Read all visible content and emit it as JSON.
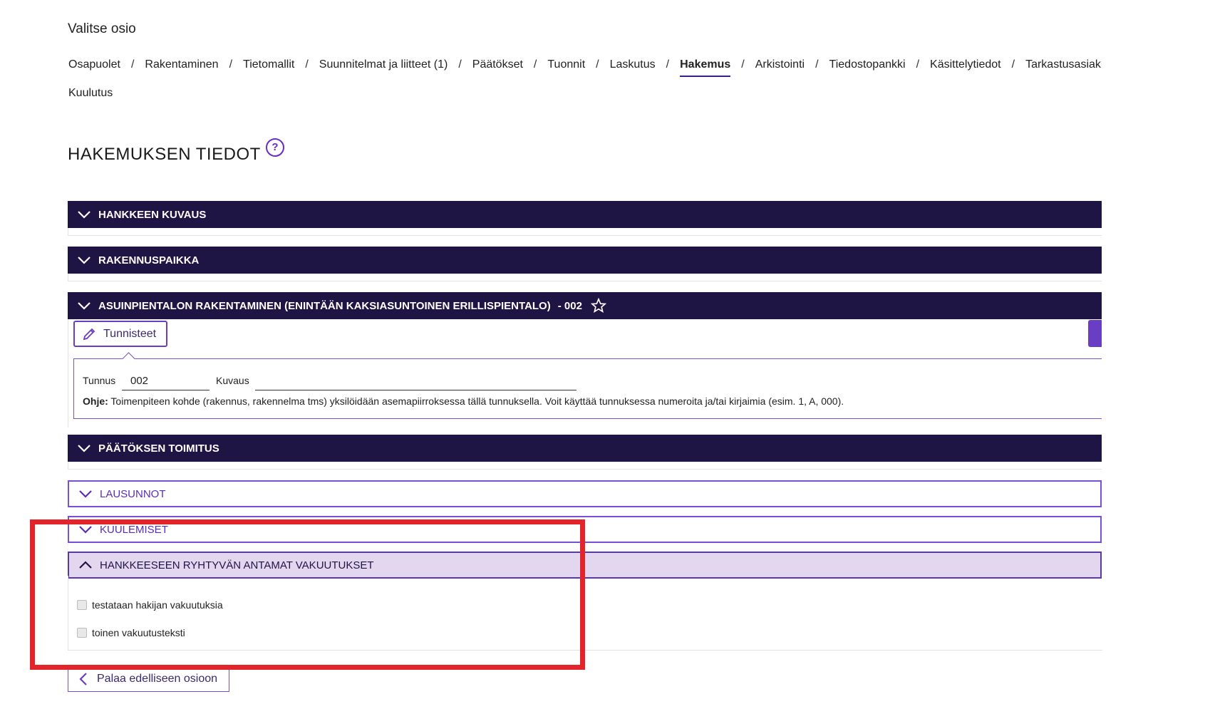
{
  "section_select": {
    "title": "Valitse osio"
  },
  "nav": {
    "items": [
      "Osapuolet",
      "Rakentaminen",
      "Tietomallit",
      "Suunnitelmat ja liitteet (1)",
      "Päätökset",
      "Tuonnit",
      "Laskutus",
      "Hakemus",
      "Arkistointi",
      "Tiedostopankki",
      "Käsittelytiedot",
      "Tarkastusasiakirja"
    ],
    "second_row": "Kuulutus",
    "separator": "/",
    "active": "Hakemus"
  },
  "page": {
    "title": "HAKEMUKSEN TIEDOT",
    "help_icon": "question-circle-icon"
  },
  "panels": {
    "hankkeen_kuvaus": "HANKKEEN KUVAUS",
    "rakennuspaikka": "RAKENNUSPAIKKA",
    "asuinpientalo": "ASUINPIENTALON RAKENTAMINEN (ENINTÄÄN KAKSIASUNTOINEN ERILLISPIENTALO)",
    "asuinpientalo_suffix": "- 002",
    "paatoksen_toimitus": "PÄÄTÖKSEN TOIMITUS",
    "lausunnot": "LAUSUNNOT",
    "kuulemiset": "KUULEMISET",
    "vakuutukset": "HANKKEESEEN RYHTYVÄN ANTAMAT VAKUUTUKSET"
  },
  "tunnisteet": {
    "button_label": "Tunnisteet",
    "tunnus_label": "Tunnus",
    "tunnus_value": "002",
    "kuvaus_label": "Kuvaus",
    "kuvaus_value": "",
    "ohje_label": "Ohje:",
    "ohje_text": " Toimenpiteen kohde (rakennus, rakennelma tms) yksilöidään asemapiirroksessa tällä tunnuksella. Voit käyttää tunnuksessa numeroita ja/tai kirjaimia (esim. 1, A, 000)."
  },
  "vakuutukset": {
    "items": [
      {
        "label": "testataan hakijan vakuutuksia",
        "checked": true
      },
      {
        "label": "toinen vakuutusteksti",
        "checked": true
      }
    ]
  },
  "back_button": {
    "label": "Palaa edelliseen osioon"
  },
  "colors": {
    "dark_bar": "#1f1545",
    "accent_purple": "#6a3ec4",
    "highlight_red": "#e3242b",
    "light_purple": "#e3d7f0"
  }
}
